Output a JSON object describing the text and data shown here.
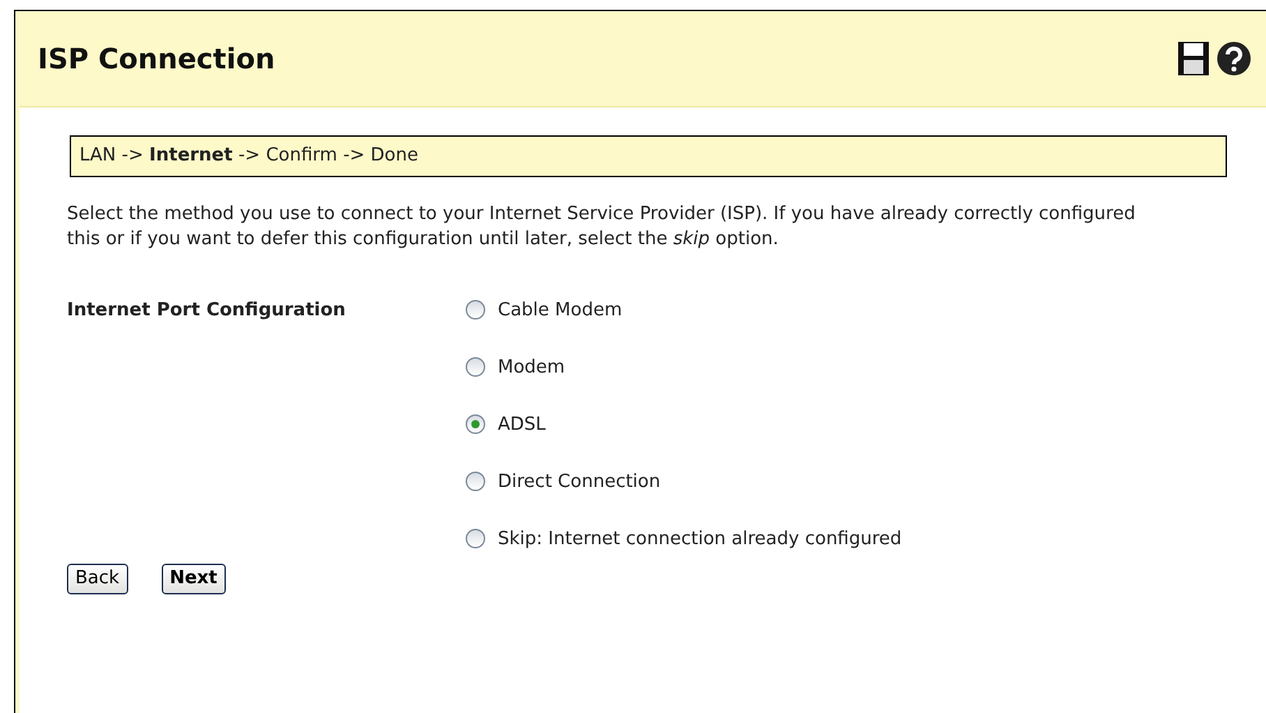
{
  "header": {
    "title": "ISP Connection"
  },
  "breadcrumb": "LAN -> **Internet** -> Confirm -> Done",
  "description": "Select the method you use to connect to your Internet Service Provider (ISP). If you have already correctly configured this or if you want to defer this configuration until later, select the *skip* option.",
  "field_label": "Internet Port Configuration",
  "options": [
    {
      "label": "Cable Modem",
      "selected": false
    },
    {
      "label": "Modem",
      "selected": false
    },
    {
      "label": "ADSL",
      "selected": true
    },
    {
      "label": "Direct Connection",
      "selected": false
    },
    {
      "label": "Skip: Internet connection already configured",
      "selected": false
    }
  ],
  "buttons": [
    {
      "label": "Back",
      "primary": false
    },
    {
      "label": "Next",
      "primary": true
    }
  ]
}
